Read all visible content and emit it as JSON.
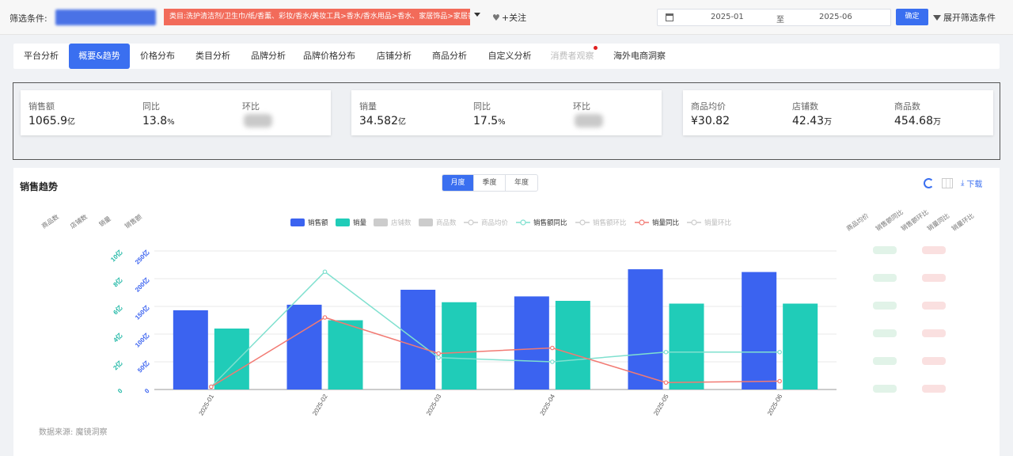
{
  "filter": {
    "label": "筛选条件:",
    "category": "类目:洗护清洁剂/卫生巾/纸/香薰、彩妆/香水/美妆工具>香水/香水用品>香水、家居饰品>家居香薰",
    "follow": "+关注",
    "date_from": "2025-01",
    "date_sep": "至",
    "date_to": "2025-06",
    "confirm": "确定",
    "expand": "展开筛选条件"
  },
  "tabs": [
    {
      "label": "平台分析",
      "state": "normal"
    },
    {
      "label": "概要&趋势",
      "state": "active"
    },
    {
      "label": "价格分布",
      "state": "normal"
    },
    {
      "label": "类目分析",
      "state": "normal"
    },
    {
      "label": "品牌分析",
      "state": "normal"
    },
    {
      "label": "品牌价格分布",
      "state": "normal"
    },
    {
      "label": "店铺分析",
      "state": "normal"
    },
    {
      "label": "商品分析",
      "state": "normal"
    },
    {
      "label": "自定义分析",
      "state": "normal"
    },
    {
      "label": "消费者观察",
      "state": "disabled"
    },
    {
      "label": "海外电商洞察",
      "state": "normal"
    }
  ],
  "metrics": {
    "sales_label": "销售额",
    "sales_value": "1065.9",
    "sales_unit": "亿",
    "sales_yoy_label": "同比",
    "sales_yoy_value": "13.8",
    "sales_yoy_unit": "%",
    "sales_mom_label": "环比",
    "volume_label": "销量",
    "volume_value": "34.582",
    "volume_unit": "亿",
    "volume_yoy_label": "同比",
    "volume_yoy_value": "17.5",
    "volume_yoy_unit": "%",
    "volume_mom_label": "环比",
    "avg_price_label": "商品均价",
    "avg_price_value": "¥30.82",
    "shops_label": "店铺数",
    "shops_value": "42.43",
    "shops_unit": "万",
    "products_label": "商品数",
    "products_value": "454.68",
    "products_unit": "万"
  },
  "panel": {
    "title": "销售趋势",
    "period_tabs": [
      "月度",
      "季度",
      "年度"
    ],
    "active_period": "月度",
    "download": "下载",
    "source": "数据来源: 魔镜洞察"
  },
  "chart_data": {
    "type": "bar",
    "categories": [
      "2025-01",
      "2025-02",
      "2025-03",
      "2025-04",
      "2025-05",
      "2025-06"
    ],
    "series": [
      {
        "name": "销售额",
        "kind": "bar",
        "color": "#3b63f0",
        "axis": "left_sales",
        "values": [
          143,
          153,
          180,
          168,
          217,
          212
        ]
      },
      {
        "name": "销量",
        "kind": "bar",
        "color": "#20ccb8",
        "axis": "left_volume",
        "values": [
          4.4,
          5.0,
          6.3,
          6.4,
          6.2,
          6.2
        ]
      },
      {
        "name": "销售额同比",
        "kind": "line",
        "color": "#7fe0cf",
        "values": [
          0.02,
          0.85,
          0.23,
          0.2,
          0.27,
          0.27
        ]
      },
      {
        "name": "销量同比",
        "kind": "line",
        "color": "#f27a73",
        "values": [
          0.02,
          0.52,
          0.26,
          0.3,
          0.05,
          0.06
        ]
      }
    ],
    "legend": [
      {
        "name": "销售额",
        "kind": "bar",
        "color": "#3b63f0",
        "active": true
      },
      {
        "name": "销量",
        "kind": "bar",
        "color": "#20ccb8",
        "active": true
      },
      {
        "name": "店铺数",
        "kind": "bar",
        "color": "#cccccc",
        "active": false
      },
      {
        "name": "商品数",
        "kind": "bar",
        "color": "#cccccc",
        "active": false
      },
      {
        "name": "商品均价",
        "kind": "line",
        "color": "#cccccc",
        "active": false
      },
      {
        "name": "销售额同比",
        "kind": "line",
        "color": "#7fe0cf",
        "active": true
      },
      {
        "name": "销售额环比",
        "kind": "line",
        "color": "#cccccc",
        "active": false
      },
      {
        "name": "销量同比",
        "kind": "line",
        "color": "#f27a73",
        "active": true
      },
      {
        "name": "销量环比",
        "kind": "line",
        "color": "#cccccc",
        "active": false
      }
    ],
    "left_axis_names": [
      "商品数",
      "店铺数",
      "销量",
      "销售额"
    ],
    "right_axis_names": [
      "商品均价",
      "销售额同比",
      "销售额环比",
      "销量同比",
      "销量环比"
    ],
    "sales_ticks": [
      "0",
      "50亿",
      "100亿",
      "150亿",
      "200亿",
      "250亿"
    ],
    "volume_ticks": [
      "0",
      "2亿",
      "4亿",
      "6亿",
      "8亿",
      "10亿"
    ],
    "sales_ylim": [
      0,
      250
    ],
    "volume_ylim": [
      0,
      10
    ],
    "rate_ylim": [
      0,
      1
    ],
    "grid": true,
    "legend_position": "top-center"
  }
}
